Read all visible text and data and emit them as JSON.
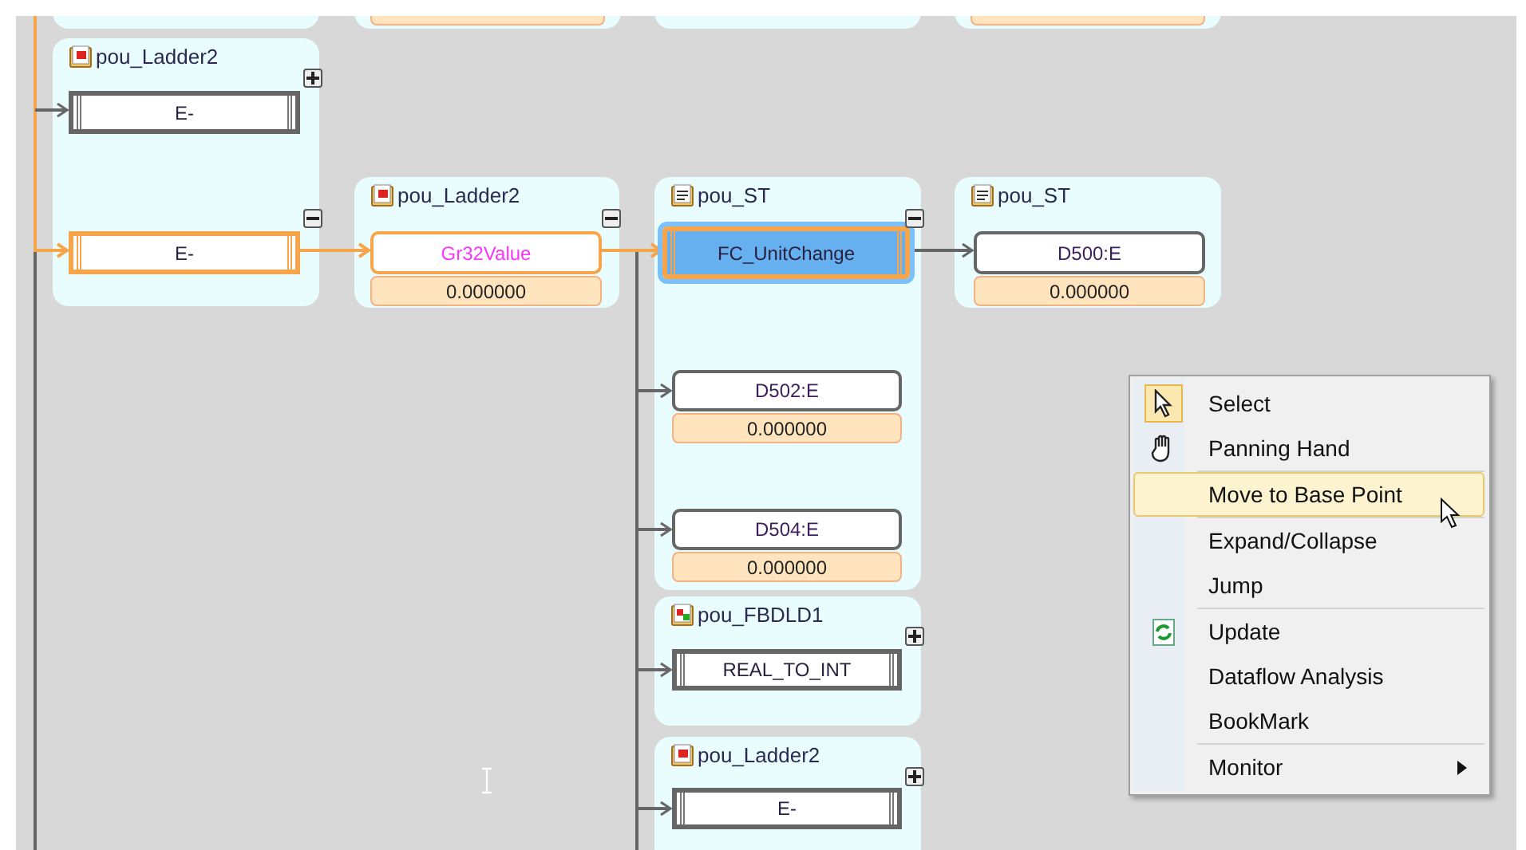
{
  "diagram": {
    "groups": [
      {
        "title": "pou_Ladder2",
        "kind": "ladder",
        "blocks": [
          {
            "kind": "function",
            "label": "E-",
            "expanded": false,
            "highlighted": false,
            "selected": false
          },
          {
            "kind": "function",
            "label": "E-",
            "expanded": true,
            "highlighted": true,
            "selected": false
          }
        ]
      },
      {
        "title": "pou_Ladder2",
        "kind": "ladder",
        "blocks": [
          {
            "kind": "variable",
            "label": "Gr32Value",
            "value": "0.000000",
            "color": "#ff33ff",
            "expanded": true,
            "highlighted": true,
            "selected": false
          }
        ]
      },
      {
        "title": "pou_ST",
        "kind": "st",
        "blocks": [
          {
            "kind": "function",
            "label": "FC_UnitChange",
            "expanded": true,
            "highlighted": true,
            "selected": true
          },
          {
            "kind": "variable",
            "label": "D502:E",
            "value": "0.000000",
            "color": "#3a1f5c",
            "highlighted": false,
            "selected": false
          },
          {
            "kind": "variable",
            "label": "D504:E",
            "value": "0.000000",
            "color": "#3a1f5c",
            "highlighted": false,
            "selected": false
          }
        ]
      },
      {
        "title": "pou_ST",
        "kind": "st",
        "blocks": [
          {
            "kind": "variable",
            "label": "D500:E",
            "value": "0.000000",
            "color": "#3a1f5c",
            "highlighted": false,
            "selected": false
          }
        ]
      },
      {
        "title": "pou_FBDLD1",
        "kind": "fbd",
        "blocks": [
          {
            "kind": "function",
            "label": "REAL_TO_INT",
            "expanded": false,
            "highlighted": false,
            "selected": false
          }
        ]
      },
      {
        "title": "pou_Ladder2",
        "kind": "ladder",
        "blocks": [
          {
            "kind": "function",
            "label": "E-",
            "expanded": false,
            "highlighted": false,
            "selected": false
          }
        ]
      }
    ]
  },
  "context_menu": {
    "sections": [
      [
        {
          "label": "Select",
          "checked": true,
          "selected": false,
          "submenu": false
        },
        {
          "label": "Panning Hand",
          "checked": false,
          "selected": false,
          "submenu": false
        }
      ],
      [
        {
          "label": "Move to Base Point",
          "checked": false,
          "selected": true,
          "submenu": false
        }
      ],
      [
        {
          "label": "Expand/Collapse",
          "checked": false,
          "selected": false,
          "submenu": false
        },
        {
          "label": "Jump",
          "checked": false,
          "selected": false,
          "submenu": false
        }
      ],
      [
        {
          "label": "Update",
          "checked": false,
          "selected": false,
          "submenu": false
        },
        {
          "label": "Dataflow Analysis",
          "checked": false,
          "selected": false,
          "submenu": false
        },
        {
          "label": "BookMark",
          "checked": false,
          "selected": false,
          "submenu": false
        }
      ],
      [
        {
          "label": "Monitor",
          "checked": false,
          "selected": false,
          "submenu": true
        }
      ]
    ]
  }
}
